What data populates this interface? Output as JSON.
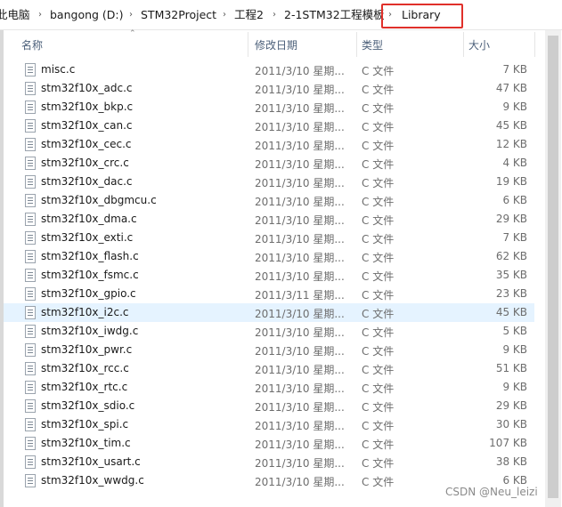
{
  "breadcrumb": {
    "items": [
      "此电脑",
      "bangong (D:)",
      "STM32Project",
      "工程2",
      "2-1STM32工程模板",
      "Library"
    ],
    "separator": "›"
  },
  "columns": {
    "name": "名称",
    "date": "修改日期",
    "type": "类型",
    "size": "大小"
  },
  "files": [
    {
      "name": "misc.c",
      "date": "2011/3/10 星期...",
      "type": "C 文件",
      "size": "7 KB"
    },
    {
      "name": "stm32f10x_adc.c",
      "date": "2011/3/10 星期...",
      "type": "C 文件",
      "size": "47 KB"
    },
    {
      "name": "stm32f10x_bkp.c",
      "date": "2011/3/10 星期...",
      "type": "C 文件",
      "size": "9 KB"
    },
    {
      "name": "stm32f10x_can.c",
      "date": "2011/3/10 星期...",
      "type": "C 文件",
      "size": "45 KB"
    },
    {
      "name": "stm32f10x_cec.c",
      "date": "2011/3/10 星期...",
      "type": "C 文件",
      "size": "12 KB"
    },
    {
      "name": "stm32f10x_crc.c",
      "date": "2011/3/10 星期...",
      "type": "C 文件",
      "size": "4 KB"
    },
    {
      "name": "stm32f10x_dac.c",
      "date": "2011/3/10 星期...",
      "type": "C 文件",
      "size": "19 KB"
    },
    {
      "name": "stm32f10x_dbgmcu.c",
      "date": "2011/3/10 星期...",
      "type": "C 文件",
      "size": "6 KB"
    },
    {
      "name": "stm32f10x_dma.c",
      "date": "2011/3/10 星期...",
      "type": "C 文件",
      "size": "29 KB"
    },
    {
      "name": "stm32f10x_exti.c",
      "date": "2011/3/10 星期...",
      "type": "C 文件",
      "size": "7 KB"
    },
    {
      "name": "stm32f10x_flash.c",
      "date": "2011/3/10 星期...",
      "type": "C 文件",
      "size": "62 KB"
    },
    {
      "name": "stm32f10x_fsmc.c",
      "date": "2011/3/10 星期...",
      "type": "C 文件",
      "size": "35 KB"
    },
    {
      "name": "stm32f10x_gpio.c",
      "date": "2011/3/11 星期...",
      "type": "C 文件",
      "size": "23 KB"
    },
    {
      "name": "stm32f10x_i2c.c",
      "date": "2011/3/10 星期...",
      "type": "C 文件",
      "size": "45 KB"
    },
    {
      "name": "stm32f10x_iwdg.c",
      "date": "2011/3/10 星期...",
      "type": "C 文件",
      "size": "5 KB"
    },
    {
      "name": "stm32f10x_pwr.c",
      "date": "2011/3/10 星期...",
      "type": "C 文件",
      "size": "9 KB"
    },
    {
      "name": "stm32f10x_rcc.c",
      "date": "2011/3/10 星期...",
      "type": "C 文件",
      "size": "51 KB"
    },
    {
      "name": "stm32f10x_rtc.c",
      "date": "2011/3/10 星期...",
      "type": "C 文件",
      "size": "9 KB"
    },
    {
      "name": "stm32f10x_sdio.c",
      "date": "2011/3/10 星期...",
      "type": "C 文件",
      "size": "29 KB"
    },
    {
      "name": "stm32f10x_spi.c",
      "date": "2011/3/10 星期...",
      "type": "C 文件",
      "size": "30 KB"
    },
    {
      "name": "stm32f10x_tim.c",
      "date": "2011/3/10 星期...",
      "type": "C 文件",
      "size": "107 KB"
    },
    {
      "name": "stm32f10x_usart.c",
      "date": "2011/3/10 星期...",
      "type": "C 文件",
      "size": "38 KB"
    },
    {
      "name": "stm32f10x_wwdg.c",
      "date": "2011/3/10 星期...",
      "type": "C 文件",
      "size": "6 KB"
    }
  ],
  "selected_file": "stm32f10x_i2c.c",
  "icons": {
    "file": "c-file-icon",
    "sort": "sort-up-icon",
    "separator": "chevron-right-icon"
  },
  "colors": {
    "highlight_box": "#e0302a",
    "selected_row": "#e5f3ff",
    "header_text": "#4c607a"
  },
  "watermark": "CSDN @Neu_leizi"
}
